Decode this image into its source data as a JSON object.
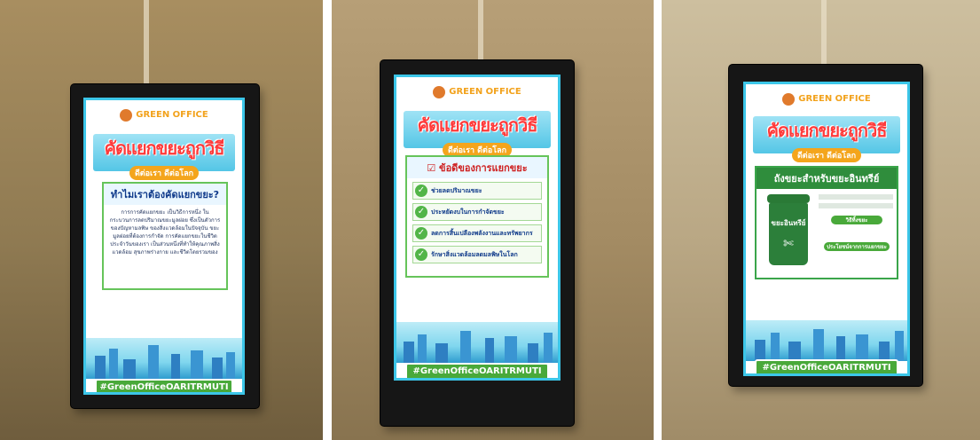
{
  "photo1": {
    "logo": "GREEN OFFICE",
    "banner_title": "คัดแยกขยะถูกวิธี",
    "banner_sub": "ดีต่อเรา ดีต่อโลก",
    "card_heading": "ทำไมเราต้องคัดแยกขยะ?",
    "card_text": "การการคัดแยกขยะ เป็นวิธีการหนึ่ง ในกระบวนการลดปริมาณขยะมูลฝอย ซึ่งเป็นตัวการของปัญหามลพิษ ของสิ่งแวดล้อมในปัจจุบัน ขยะมูลฝอยที่ต้องการกำจัด การคัดแยกขยะในชีวิตประจำวันของเรา เป็นส่วนหนึ่งที่ทำให้คุณภาพสิ่งแวดล้อม สุขภาพร่างกาย และชีวิตโดยรวมของ",
    "hashtag": "#GreenOfficeOARITRMUTI"
  },
  "photo2": {
    "logo": "GREEN OFFICE",
    "banner_title": "คัดแยกขยะถูกวิธี",
    "banner_sub": "ดีต่อเรา ดีต่อโลก",
    "card_heading": "ข้อดีของการแยกขยะ",
    "items": [
      "ช่วยลดปริมาณขยะ",
      "ประหยัดงบในการกำจัดขยะ",
      "ลดการสิ้นเปลืองพลังงานและทรัพยากร",
      "รักษาสิ่งแวดล้อมลดมลพิษในโลก"
    ],
    "hashtag": "#GreenOfficeOARITRMUTI"
  },
  "photo3": {
    "logo": "GREEN OFFICE",
    "banner_title": "คัดแยกขยะถูกวิธี",
    "banner_sub": "ดีต่อเรา ดีต่อโลก",
    "card_heading": "ถังขยะสำหรับขยะอินทรีย์",
    "bin_label": "ขยะอินทรีย์",
    "tag_1": "วิธีทิ้งขยะ",
    "tag_2": "ประโยชน์จากการแยกขยะ",
    "hashtag": "#GreenOfficeOARITRMUTI"
  }
}
